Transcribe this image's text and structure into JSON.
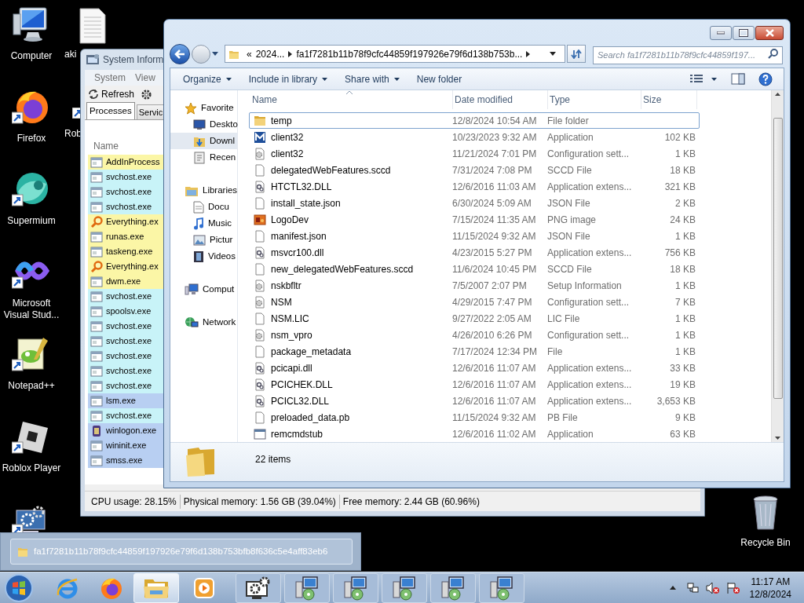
{
  "desktop_icons": [
    {
      "label": "Computer",
      "kind": "computer",
      "shortcut": false
    },
    {
      "label": "Firefox",
      "kind": "firefox",
      "shortcut": true
    },
    {
      "label": "Supermium",
      "kind": "sphere",
      "shortcut": true
    },
    {
      "label": "Microsoft Visual Stud...",
      "kind": "infinity",
      "shortcut": true
    },
    {
      "label": "Notepad++",
      "kind": "notepad",
      "shortcut": true
    },
    {
      "label": "Roblox Player",
      "kind": "roblox",
      "shortcut": true
    },
    {
      "kind": "settings",
      "shortcut": true
    }
  ],
  "desktop_icons_column_2": [
    {
      "label": "aki",
      "kind": "document",
      "shortcut": false
    },
    {
      "label": "Rob",
      "kind": "covered",
      "shortcut": true
    }
  ],
  "recycle_bin": {
    "label": "Recycle Bin"
  },
  "system_informer": {
    "title": "System Inform",
    "menu": [
      "System",
      "View"
    ],
    "toolbar": [
      {
        "label": "Refresh"
      }
    ],
    "tabs": [
      {
        "label": "Processes",
        "selected": true
      },
      {
        "label": "Servic",
        "selected": false
      }
    ],
    "column": "Name",
    "processes": [
      {
        "name": "AddInProcess",
        "kind": "app",
        "color": "#fbf6a6"
      },
      {
        "name": "svchost.exe",
        "kind": "app",
        "color": "#c8f3f8"
      },
      {
        "name": "svchost.exe",
        "kind": "app",
        "color": "#c8f3f8"
      },
      {
        "name": "svchost.exe",
        "kind": "app",
        "color": "#c8f3f8"
      },
      {
        "name": "Everything.ex",
        "kind": "search",
        "color": "#fbf6a6"
      },
      {
        "name": "runas.exe",
        "kind": "app",
        "color": "#fbf6a6"
      },
      {
        "name": "taskeng.exe",
        "kind": "app",
        "color": "#fbf6a6"
      },
      {
        "name": "Everything.ex",
        "kind": "search",
        "color": "#fbf6a6"
      },
      {
        "name": "dwm.exe",
        "kind": "app",
        "color": "#fbf6a6"
      },
      {
        "name": "svchost.exe",
        "kind": "app",
        "color": "#c8f3f8"
      },
      {
        "name": "spoolsv.exe",
        "kind": "app",
        "color": "#c8f3f8"
      },
      {
        "name": "svchost.exe",
        "kind": "app",
        "color": "#c8f3f8"
      },
      {
        "name": "svchost.exe",
        "kind": "app",
        "color": "#c8f3f8"
      },
      {
        "name": "svchost.exe",
        "kind": "app",
        "color": "#c8f3f8"
      },
      {
        "name": "svchost.exe",
        "kind": "app",
        "color": "#c8f3f8"
      },
      {
        "name": "svchost.exe",
        "kind": "app",
        "color": "#c8f3f8"
      },
      {
        "name": "lsm.exe",
        "kind": "app",
        "color": "#b8cff2"
      },
      {
        "name": "svchost.exe",
        "kind": "app",
        "color": "#c8f3f8"
      },
      {
        "name": "winlogon.exe",
        "kind": "logon",
        "color": "#b8cff2"
      },
      {
        "name": "wininit.exe",
        "kind": "app",
        "color": "#b8cff2"
      },
      {
        "name": "smss.exe",
        "kind": "app",
        "color": "#b8cff2"
      }
    ],
    "status_bar": [
      "CPU usage: 28.15%",
      "Physical memory: 1.56 GB (39.04%)",
      "Free memory: 2.44 GB (60.96%)"
    ]
  },
  "explorer": {
    "address": {
      "overflow": "«",
      "crumbs": [
        "2024...",
        "fa1f7281b11b78f9cfc44859f197926e79f6d138b753b..."
      ]
    },
    "search": {
      "placeholder": "Search fa1f7281b11b78f9cfc44859f197..."
    },
    "toolbar": [
      {
        "label": "Organize",
        "dropdown": true
      },
      {
        "label": "Include in library",
        "dropdown": true
      },
      {
        "label": "Share with",
        "dropdown": true
      },
      {
        "label": "New folder",
        "dropdown": false
      }
    ],
    "nav": [
      {
        "label": "Favorite",
        "kind": "star",
        "selected": false,
        "children": [
          {
            "label": "Deskto",
            "kind": "desktop",
            "selected": false
          },
          {
            "label": "Downl",
            "kind": "downloads",
            "selected": true
          },
          {
            "label": "Recen",
            "kind": "recent",
            "selected": false
          }
        ]
      },
      {
        "label": "Libraries",
        "kind": "library",
        "selected": false,
        "children": [
          {
            "label": "Docu",
            "kind": "document",
            "selected": false
          },
          {
            "label": "Music",
            "kind": "music",
            "selected": false
          },
          {
            "label": "Pictur",
            "kind": "pictures",
            "selected": false
          },
          {
            "label": "Videos",
            "kind": "videos",
            "selected": false
          }
        ]
      },
      {
        "label": "Comput",
        "kind": "computer",
        "selected": false
      },
      {
        "label": "Network",
        "kind": "network",
        "selected": false
      }
    ],
    "columns": [
      "Name",
      "Date modified",
      "Type",
      "Size"
    ],
    "files": [
      {
        "name": "temp",
        "date": "12/8/2024 10:54 AM",
        "type": "File folder",
        "kind": "folder",
        "selected": true
      },
      {
        "name": "client32",
        "date": "10/23/2023 9:32 AM",
        "type": "Application",
        "size": "102 KB",
        "kind": "app-logo",
        "selected": false
      },
      {
        "name": "client32",
        "date": "11/21/2024 7:01 PM",
        "type": "Configuration sett...",
        "size": "1 KB",
        "kind": "config",
        "selected": false
      },
      {
        "name": "delegatedWebFeatures.sccd",
        "date": "7/31/2024 7:08 PM",
        "type": "SCCD File",
        "size": "18 KB",
        "kind": "file",
        "selected": false
      },
      {
        "name": "HTCTL32.DLL",
        "date": "12/6/2016 11:03 AM",
        "type": "Application extens...",
        "size": "321 KB",
        "kind": "dll",
        "selected": false
      },
      {
        "name": "install_state.json",
        "date": "6/30/2024 5:09 AM",
        "type": "JSON File",
        "size": "2 KB",
        "kind": "file",
        "selected": false
      },
      {
        "name": "LogoDev",
        "date": "7/15/2024 11:35 AM",
        "type": "PNG image",
        "size": "24 KB",
        "kind": "image",
        "selected": false
      },
      {
        "name": "manifest.json",
        "date": "11/15/2024 9:32 AM",
        "type": "JSON File",
        "size": "1 KB",
        "kind": "file",
        "selected": false
      },
      {
        "name": "msvcr100.dll",
        "date": "4/23/2015 5:27 PM",
        "type": "Application extens...",
        "size": "756 KB",
        "kind": "dll",
        "selected": false
      },
      {
        "name": "new_delegatedWebFeatures.sccd",
        "date": "11/6/2024 10:45 PM",
        "type": "SCCD File",
        "size": "18 KB",
        "kind": "file",
        "selected": false
      },
      {
        "name": "nskbfltr",
        "date": "7/5/2007 2:07 PM",
        "type": "Setup Information",
        "size": "1 KB",
        "kind": "config",
        "selected": false
      },
      {
        "name": "NSM",
        "date": "4/29/2015 7:47 PM",
        "type": "Configuration sett...",
        "size": "7 KB",
        "kind": "config",
        "selected": false
      },
      {
        "name": "NSM.LIC",
        "date": "9/27/2022 2:05 AM",
        "type": "LIC File",
        "size": "1 KB",
        "kind": "file",
        "selected": false
      },
      {
        "name": "nsm_vpro",
        "date": "4/26/2010 6:26 PM",
        "type": "Configuration sett...",
        "size": "1 KB",
        "kind": "config",
        "selected": false
      },
      {
        "name": "package_metadata",
        "date": "7/17/2024 12:34 PM",
        "type": "File",
        "size": "1 KB",
        "kind": "file",
        "selected": false
      },
      {
        "name": "pcicapi.dll",
        "date": "12/6/2016 11:07 AM",
        "type": "Application extens...",
        "size": "33 KB",
        "kind": "dll",
        "selected": false
      },
      {
        "name": "PCICHEK.DLL",
        "date": "12/6/2016 11:07 AM",
        "type": "Application extens...",
        "size": "19 KB",
        "kind": "dll",
        "selected": false
      },
      {
        "name": "PCICL32.DLL",
        "date": "12/6/2016 11:07 AM",
        "type": "Application extens...",
        "size": "3,653 KB",
        "kind": "dll",
        "selected": false
      },
      {
        "name": "preloaded_data.pb",
        "date": "11/15/2024 9:32 AM",
        "type": "PB File",
        "size": "9 KB",
        "kind": "file",
        "selected": false
      },
      {
        "name": "remcmdstub",
        "date": "12/6/2016 11:02 AM",
        "type": "Application",
        "size": "63 KB",
        "kind": "app",
        "selected": false
      }
    ],
    "item_count": "22 items"
  },
  "thumbnail_popup": {
    "title": "fa1f7281b11b78f9cfc44859f197926e79f6d138b753bfb8f636c5e4aff83eb6"
  },
  "taskbar": {
    "buttons": [
      {
        "kind": "ie",
        "selected": false
      },
      {
        "kind": "firefox",
        "selected": false
      },
      {
        "kind": "explorer",
        "selected": true
      },
      {
        "kind": "media",
        "selected": false
      },
      {
        "kind": "settings",
        "selected": false
      },
      {
        "kind": "installer",
        "selected": false
      },
      {
        "kind": "installer",
        "selected": false
      },
      {
        "kind": "installer",
        "selected": false
      },
      {
        "kind": "installer",
        "selected": false
      },
      {
        "kind": "installer",
        "selected": false
      }
    ],
    "clock": {
      "time": "11:17 AM",
      "date": "12/8/2024"
    }
  }
}
